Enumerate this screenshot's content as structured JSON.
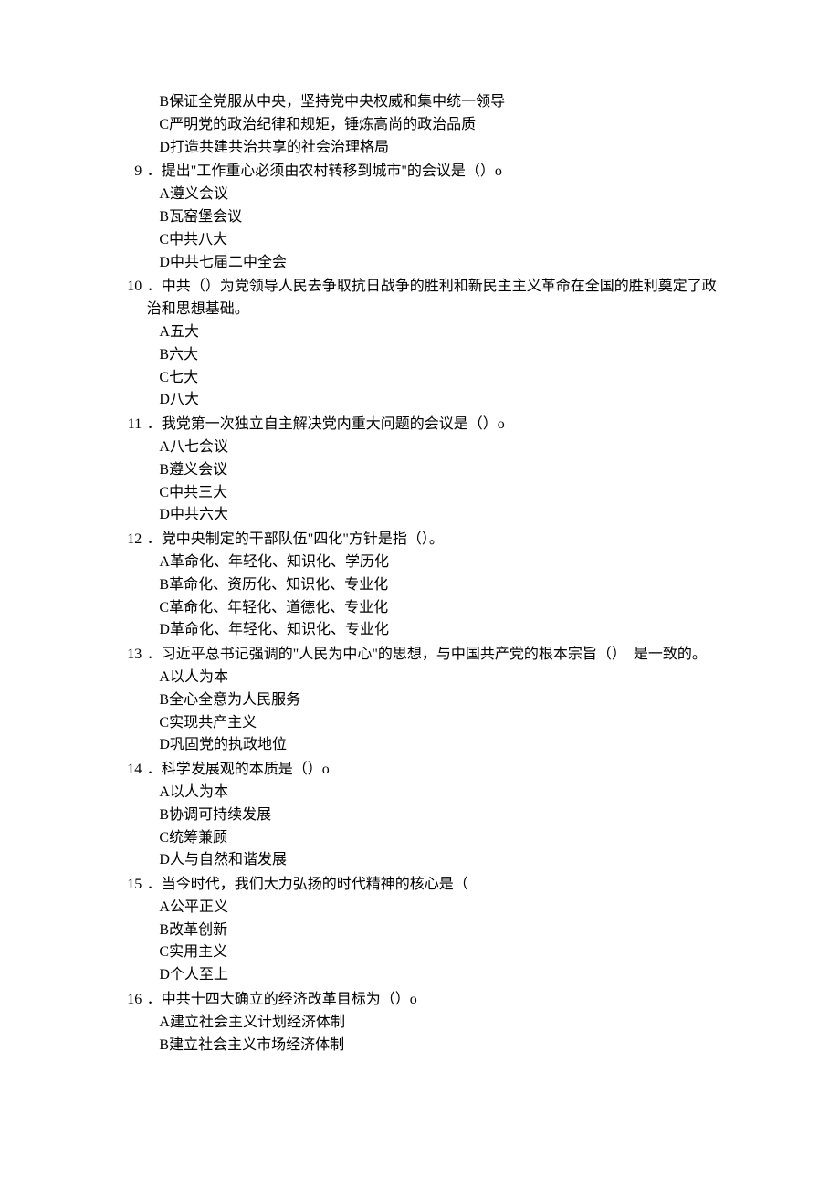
{
  "orphanOptions": [
    "B保证全党服从中央，坚持党中央权威和集中统一领导",
    "C严明党的政治纪律和规矩，锤炼高尚的政治品质",
    "D打造共建共治共享的社会治理格局"
  ],
  "questions": [
    {
      "num": "9",
      "stem": "．提出\"工作重心必须由农村转移到城市\"的会议是（）o",
      "options": [
        "A遵义会议",
        "B瓦窑堡会议",
        "C中共八大",
        "D中共七届二中全会"
      ]
    },
    {
      "num": "10",
      "stem": "．中共（）为党领导人民去争取抗日战争的胜利和新民主主义革命在全国的胜利奠定了政治和思想基础。",
      "options": [
        "A五大",
        "B六大",
        "C七大",
        "D八大"
      ]
    },
    {
      "num": "11",
      "stem": "．我党第一次独立自主解决党内重大问题的会议是（）o",
      "options": [
        "A八七会议",
        "B遵义会议",
        "C中共三大",
        "D中共六大"
      ]
    },
    {
      "num": "12",
      "stem": "．党中央制定的干部队伍\"四化\"方针是指（）。",
      "options": [
        "A革命化、年轻化、知识化、学历化",
        "B革命化、资历化、知识化、专业化",
        "C革命化、年轻化、道德化、专业化",
        "D革命化、年轻化、知识化、专业化"
      ]
    },
    {
      "num": "13",
      "stem": "．习近平总书记强调的\"人民为中心\"的思想，与中国共产党的根本宗旨（）　是一致的。",
      "options": [
        "A以人为本",
        "B全心全意为人民服务",
        "C实现共产主义",
        "D巩固党的执政地位"
      ]
    },
    {
      "num": "14",
      "stem": "．科学发展观的本质是（）o",
      "options": [
        "A以人为本",
        "B协调可持续发展",
        "C统筹兼顾",
        "D人与自然和谐发展"
      ]
    },
    {
      "num": "15",
      "stem": "．当今时代，我们大力弘扬的时代精神的核心是（",
      "options": [
        "A公平正义",
        "B改革创新",
        "C实用主义",
        "D个人至上"
      ]
    },
    {
      "num": "16",
      "stem": "．中共十四大确立的经济改革目标为（）o",
      "options": [
        "A建立社会主义计划经济体制",
        "B建立社会主义市场经济体制"
      ]
    }
  ]
}
